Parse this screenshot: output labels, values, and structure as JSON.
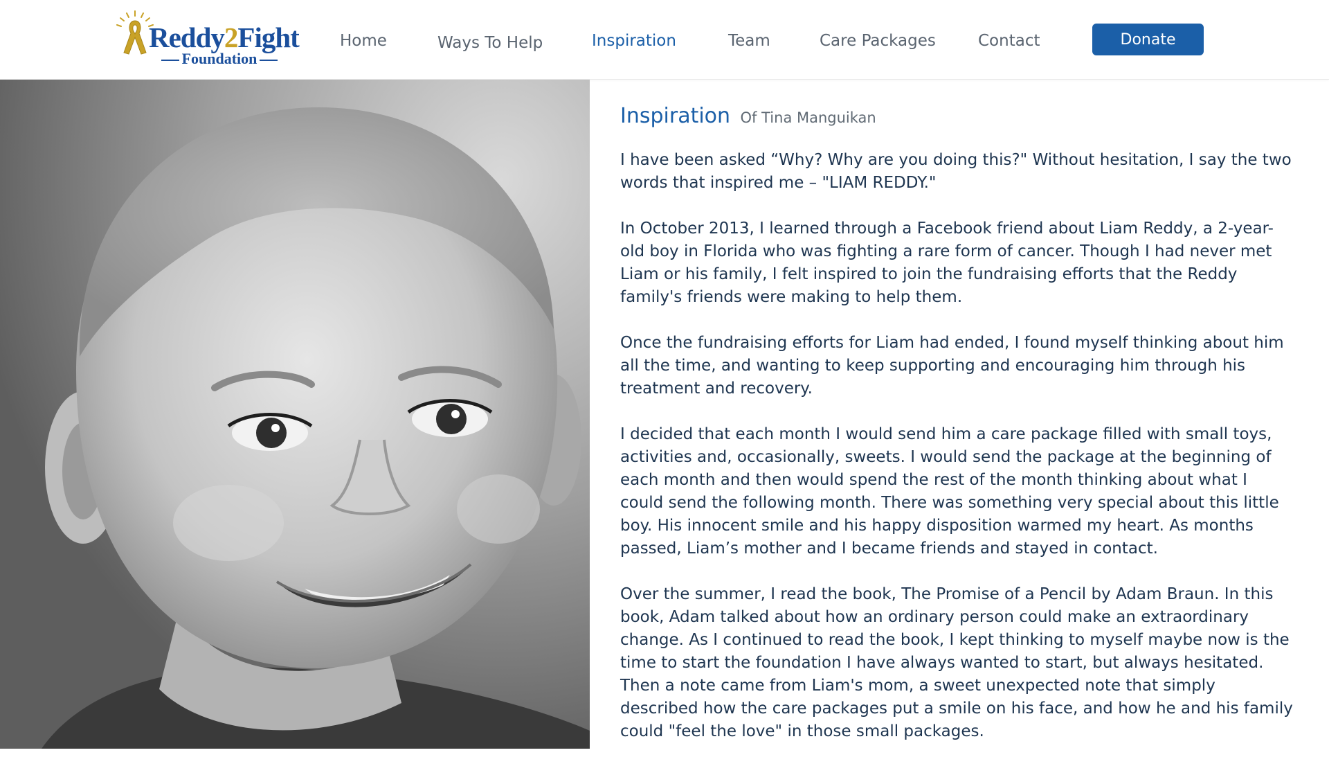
{
  "logo": {
    "title_left": "Reddy",
    "title_num": "2",
    "title_right": "Fight",
    "subtitle": "Foundation",
    "icon": "gold-ribbon-icon"
  },
  "nav": {
    "items": [
      {
        "label": "Home"
      },
      {
        "label": "Ways To Help"
      },
      {
        "label": "Inspiration",
        "active": true
      },
      {
        "label": "Team"
      },
      {
        "label": "Care Packages"
      },
      {
        "label": "Contact"
      }
    ],
    "donate_label": "Donate"
  },
  "colors": {
    "brand_blue": "#1b5fa8",
    "logo_gold": "#c9a227",
    "text": "#1e3550",
    "nav_text": "#5a6470"
  },
  "content": {
    "heading": "Inspiration",
    "subheading": "Of Tina Manguikan",
    "paragraphs": [
      "I have been asked “Why? Why are you doing this?\" Without hesitation, I say the two words that inspired me – \"LIAM REDDY.\"",
      "In October 2013, I learned through a Facebook friend about Liam Reddy, a 2-year-old boy in Florida who was fighting a rare form of cancer. Though I had never met Liam or his family, I felt inspired to join the fundraising efforts that the Reddy family's friends were making to help them.",
      "Once the fundraising efforts for Liam had ended, I found myself thinking about him all the time, and wanting to keep supporting and encouraging him through his treatment and recovery.",
      "I decided that each month I would send him a care package filled with small toys, activities and, occasionally, sweets. I would send the package at the beginning of each month and then would spend the rest of the month thinking about what I could send the following month. There was something very special about this little boy. His innocent smile and his happy disposition warmed my heart. As months passed, Liam’s mother and I became friends and stayed in contact.",
      "Over the summer, I read the book, The Promise of a Pencil by Adam Braun. In this book, Adam talked about how an ordinary person could make an extraordinary change. As I continued to read the book, I kept thinking to myself maybe now is the time to start the foundation I have always wanted to start, but always hesitated. Then a note came from Liam's mom, a sweet unexpected note that simply described how the care packages put a smile on his face, and how he and his family could \"feel the love\" in those small packages."
    ]
  }
}
